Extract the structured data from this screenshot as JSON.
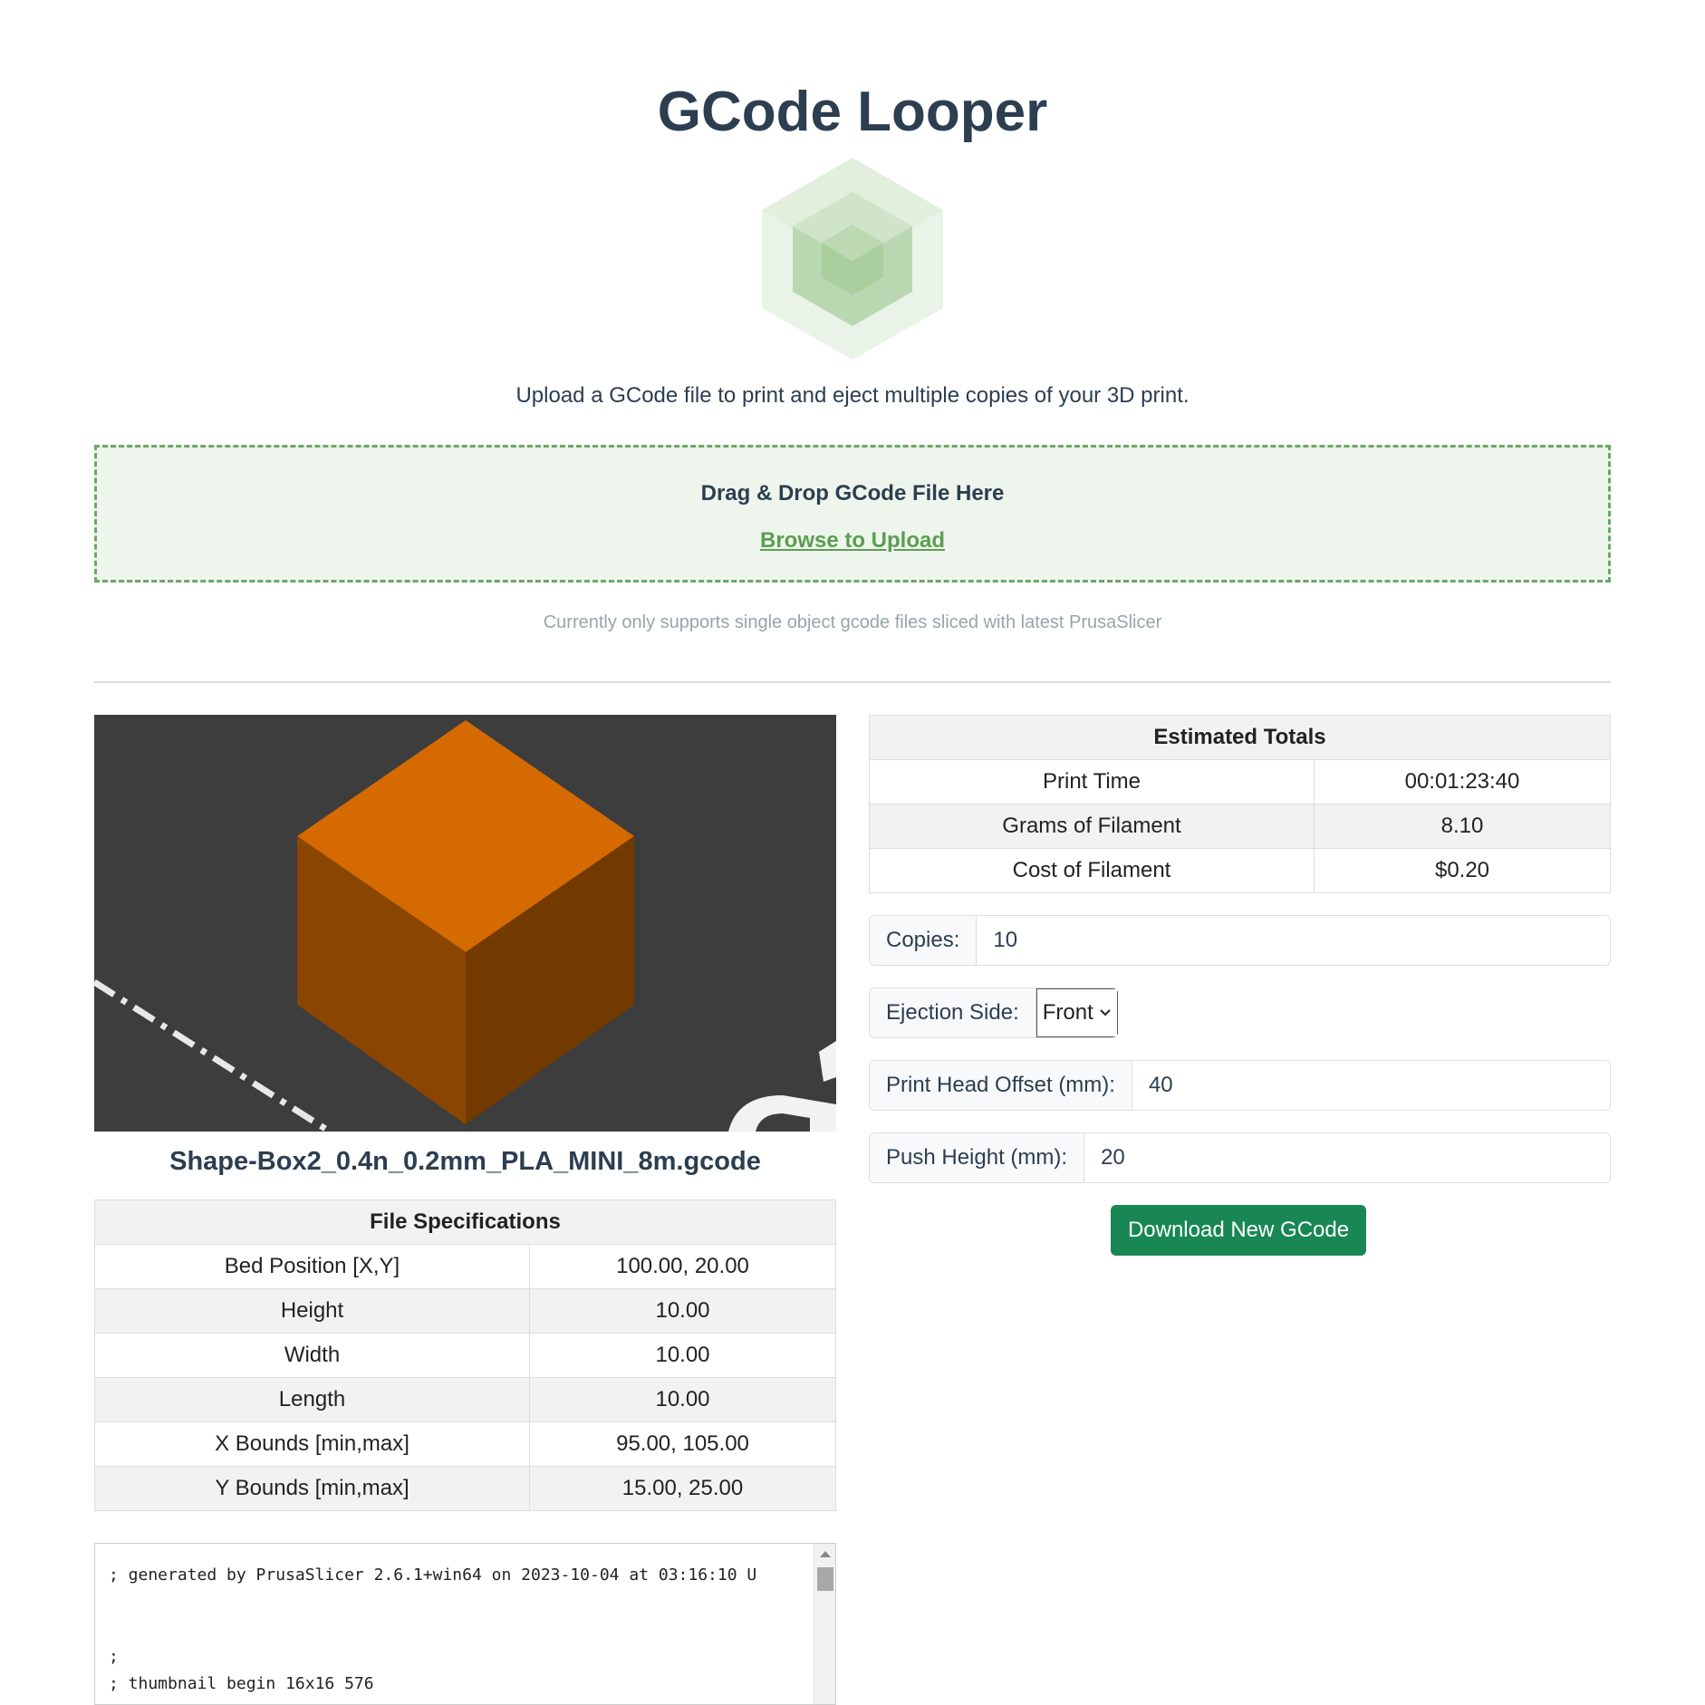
{
  "header": {
    "title": "GCode Looper",
    "tagline": "Upload a GCode file to print and eject multiple copies of your 3D print."
  },
  "upload": {
    "drop_title": "Drag & Drop GCode File Here",
    "browse_label": "Browse to Upload",
    "support_note": "Currently only supports single object gcode files sliced with latest PrusaSlicer"
  },
  "file": {
    "name": "Shape-Box2_0.4n_0.2mm_PLA_MINI_8m.gcode"
  },
  "file_specs": {
    "title": "File Specifications",
    "rows": [
      {
        "label": "Bed Position [X,Y]",
        "value": "100.00, 20.00"
      },
      {
        "label": "Height",
        "value": "10.00"
      },
      {
        "label": "Width",
        "value": "10.00"
      },
      {
        "label": "Length",
        "value": "10.00"
      },
      {
        "label": "X Bounds [min,max]",
        "value": "95.00, 105.00"
      },
      {
        "label": "Y Bounds [min,max]",
        "value": "15.00, 25.00"
      }
    ]
  },
  "totals": {
    "title": "Estimated Totals",
    "rows": [
      {
        "label": "Print Time",
        "value": "00:01:23:40"
      },
      {
        "label": "Grams of Filament",
        "value": "8.10"
      },
      {
        "label": "Cost of Filament",
        "value": "$0.20"
      }
    ]
  },
  "settings": {
    "copies_label": "Copies:",
    "copies_value": "10",
    "ejection_label": "Ejection Side:",
    "ejection_value": "Front",
    "offset_label": "Print Head Offset (mm):",
    "offset_value": "40",
    "push_label": "Push Height (mm):",
    "push_value": "20",
    "download_label": "Download New GCode"
  },
  "gcode_preview": {
    "lines": [
      "; generated by PrusaSlicer 2.6.1+win64 on 2023-10-04 at 03:16:10 U",
      "",
      "",
      ";",
      "; thumbnail begin 16x16 576"
    ]
  },
  "colors": {
    "heading": "#2c3e50",
    "accent_green": "#5a9e52",
    "dropzone_bg": "#eef5ec",
    "button_green": "#198754",
    "cube_orange": "#d46a00"
  }
}
